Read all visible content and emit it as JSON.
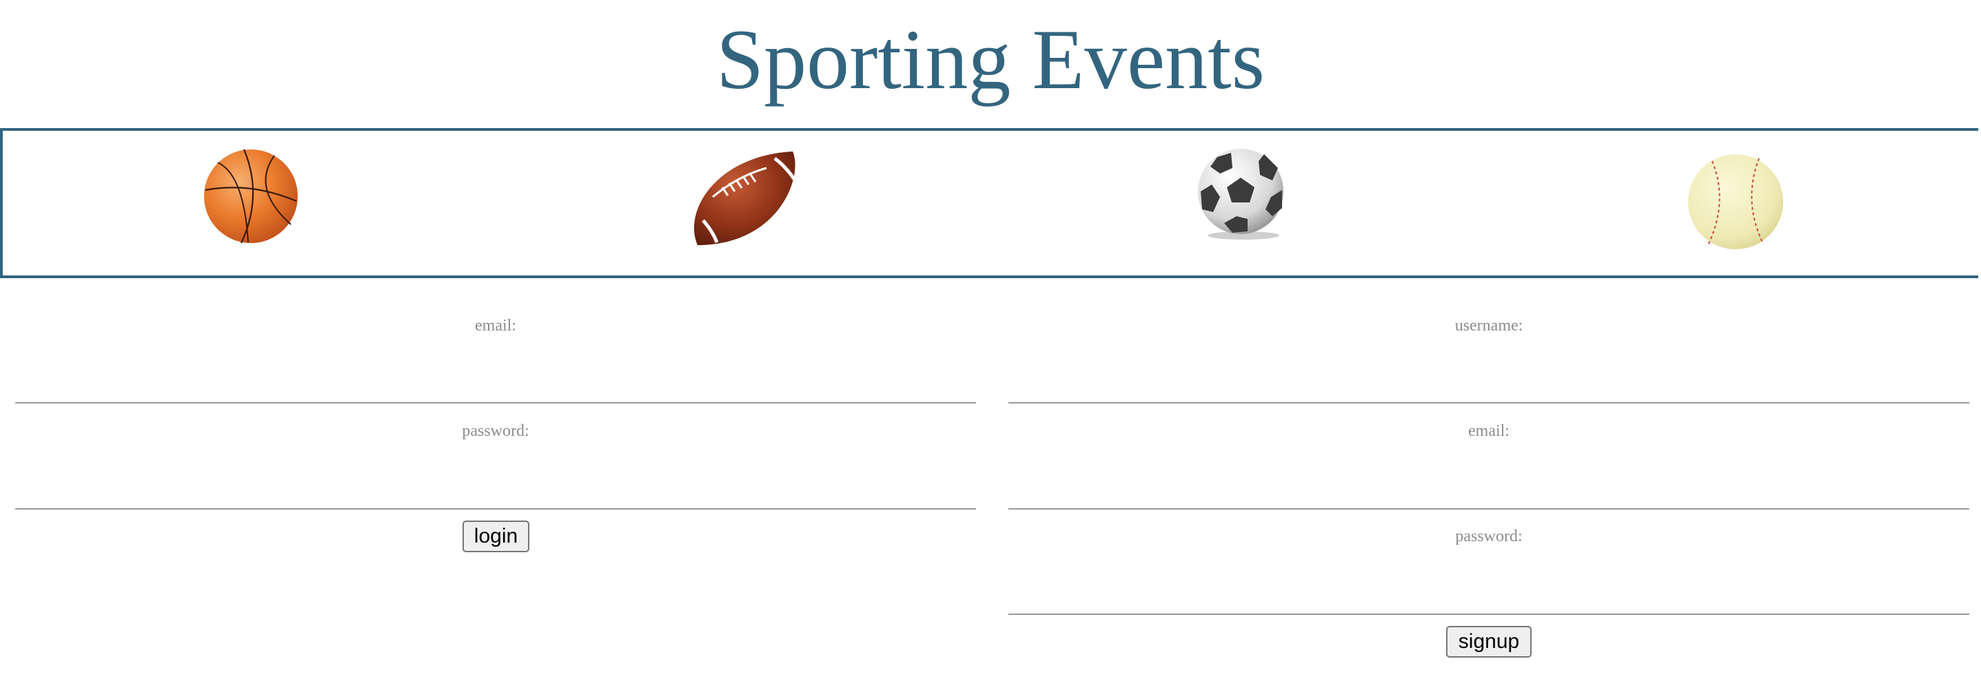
{
  "header": {
    "title": "Sporting Events"
  },
  "banner": {
    "balls": [
      {
        "name": "basketball-icon"
      },
      {
        "name": "football-icon"
      },
      {
        "name": "soccer-ball-icon"
      },
      {
        "name": "baseball-icon"
      }
    ],
    "border_color": "#33657f"
  },
  "login": {
    "email_label": "email:",
    "email_value": "",
    "password_label": "password:",
    "password_value": "",
    "button_label": "login"
  },
  "signup": {
    "username_label": "username:",
    "username_value": "",
    "email_label": "email:",
    "email_value": "",
    "password_label": "password:",
    "password_value": "",
    "button_label": "signup"
  },
  "colors": {
    "accent": "#33657f",
    "label": "#8c8c8c"
  }
}
